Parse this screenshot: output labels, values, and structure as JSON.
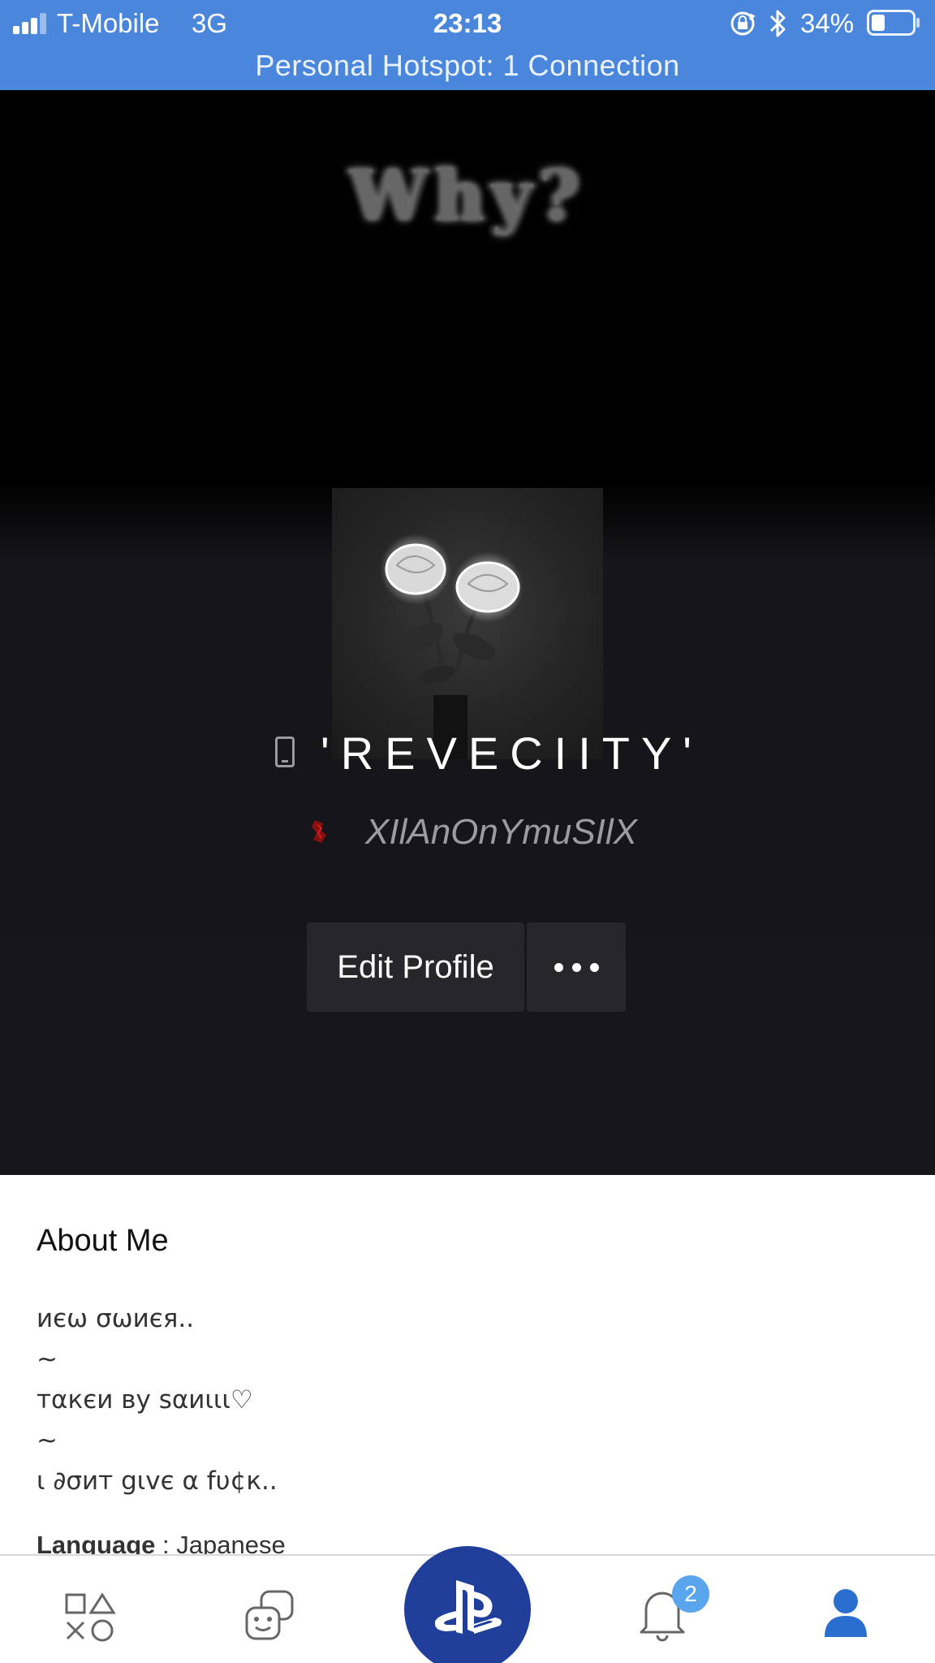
{
  "status_bar": {
    "carrier": "T-Mobile",
    "network": "3G",
    "time": "23:13",
    "battery": "34%",
    "battery_level": 0.34,
    "hotspot": "Personal Hotspot: 1 Connection",
    "bar_color": "#4a86dc"
  },
  "header": {
    "banner_text": "Why?",
    "display_name": "'REVECIITY'",
    "online_id": "XIlAnOnYmuSIlX"
  },
  "actions": {
    "edit_profile": "Edit Profile",
    "more_icon": "more-dots-icon"
  },
  "about": {
    "title": "About Me",
    "lines": [
      "иєω σωиєя..",
      "~",
      "тαкєи ву ѕαиιιι♡",
      "~",
      "ι ∂σит gιvє α fυ¢к.."
    ],
    "language_label": "Language",
    "language_value": ": Japanese"
  },
  "tabbar": {
    "tabs": [
      "game-library-icon",
      "friends-icon",
      "playstation-home-icon",
      "notifications-icon",
      "profile-icon"
    ],
    "notification_count": "2",
    "accent": "#1f3f9a",
    "active_color": "#2a6fd0"
  }
}
